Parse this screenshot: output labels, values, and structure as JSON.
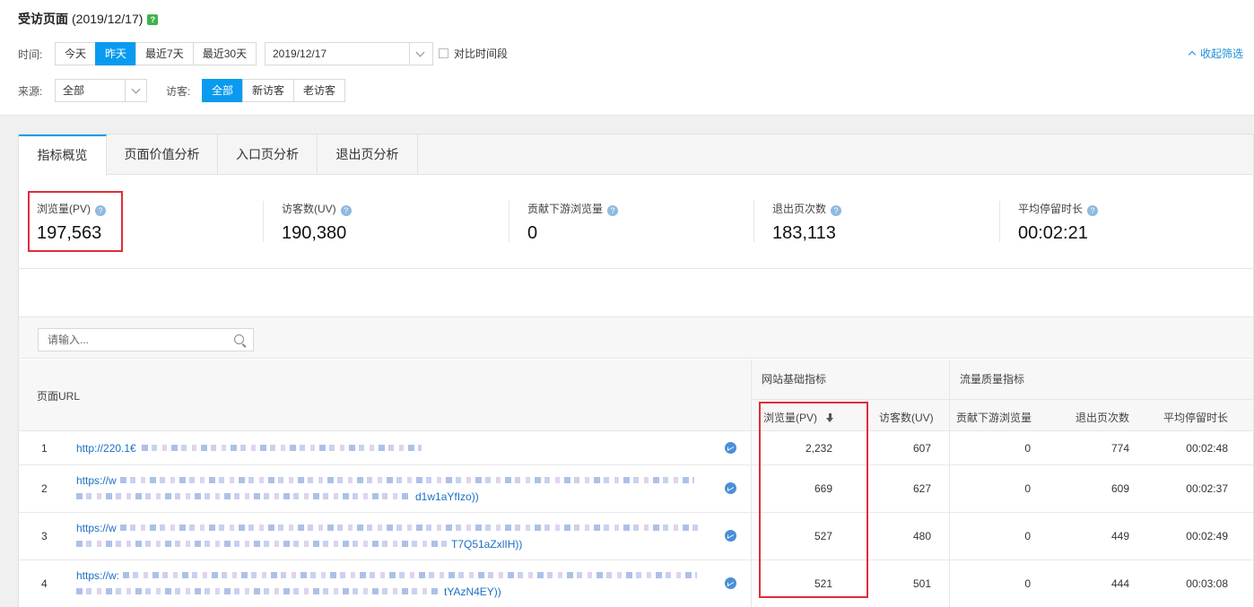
{
  "header": {
    "title": "受访页面",
    "date": "(2019/12/17)",
    "help": "?"
  },
  "filters": {
    "time_label": "时间:",
    "time_buttons": [
      "今天",
      "昨天",
      "最近7天",
      "最近30天"
    ],
    "time_active": "昨天",
    "date_value": "2019/12/17",
    "compare_label": "对比时间段",
    "collapse_label": "收起筛选",
    "source_label": "来源:",
    "source_value": "全部",
    "visitor_label": "访客:",
    "visitor_buttons": [
      "全部",
      "新访客",
      "老访客"
    ],
    "visitor_active": "全部"
  },
  "tabs": [
    "指标概览",
    "页面价值分析",
    "入口页分析",
    "退出页分析"
  ],
  "metrics": [
    {
      "label": "浏览量(PV)",
      "value": "197,563"
    },
    {
      "label": "访客数(UV)",
      "value": "190,380"
    },
    {
      "label": "贡献下游浏览量",
      "value": "0"
    },
    {
      "label": "退出页次数",
      "value": "183,113"
    },
    {
      "label": "平均停留时长",
      "value": "00:02:21"
    }
  ],
  "search": {
    "placeholder": "请输入..."
  },
  "table": {
    "url_header": "页面URL",
    "group1": "网站基础指标",
    "group2": "流量质量指标",
    "columns": [
      "浏览量(PV)",
      "访客数(UV)",
      "贡献下游浏览量",
      "退出页次数",
      "平均停留时长"
    ],
    "rows": [
      {
        "idx": "1",
        "url1": "http://220.1€",
        "url2": "",
        "pv": "2,232",
        "uv": "607",
        "down": "0",
        "exits": "774",
        "time": "00:02:48"
      },
      {
        "idx": "2",
        "url1": "https://w",
        "url2": "d1w1aYfIzo))",
        "pv": "669",
        "uv": "627",
        "down": "0",
        "exits": "609",
        "time": "00:02:37"
      },
      {
        "idx": "3",
        "url1": "https://w",
        "url2": "T7Q51aZxlIH))",
        "pv": "527",
        "uv": "480",
        "down": "0",
        "exits": "449",
        "time": "00:02:49"
      },
      {
        "idx": "4",
        "url1": "https://w:",
        "url2": "tYAzN4EY))",
        "pv": "521",
        "uv": "501",
        "down": "0",
        "exits": "444",
        "time": "00:03:08"
      }
    ]
  },
  "colors": {
    "accent": "#0a9bf0",
    "highlight": "#e02d3a",
    "link": "#1a6fc4",
    "help_green": "#3fb34f"
  }
}
